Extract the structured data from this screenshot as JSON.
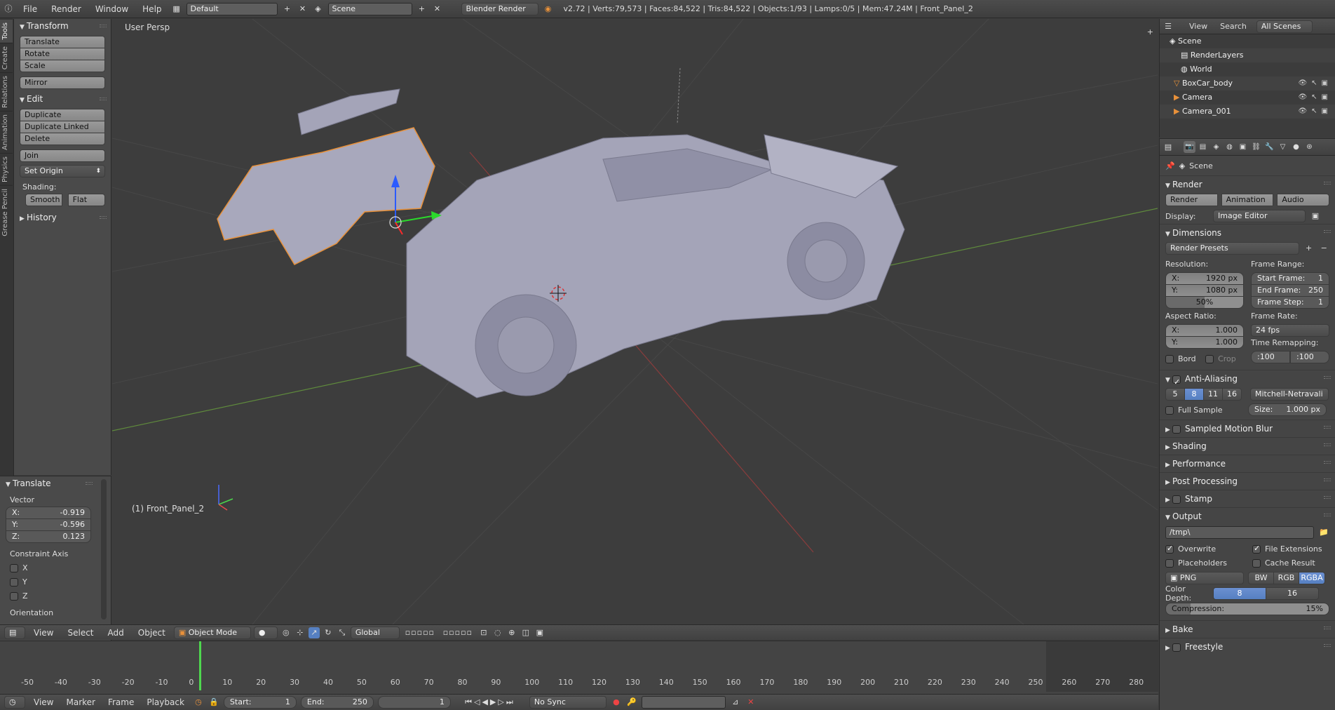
{
  "topbar": {
    "menus": [
      "File",
      "Render",
      "Window",
      "Help"
    ],
    "layout": "Default",
    "scene": "Scene",
    "engine": "Blender Render",
    "stats": "v2.72 | Verts:79,573 | Faces:84,522 | Tris:84,522 | Objects:1/93 | Lamps:0/5 | Mem:47.24M | Front_Panel_2"
  },
  "tabs": [
    "Tools",
    "Create",
    "Relations",
    "Animation",
    "Physics",
    "Grease Pencil"
  ],
  "shelf": {
    "transform_title": "Transform",
    "translate": "Translate",
    "rotate": "Rotate",
    "scale": "Scale",
    "mirror": "Mirror",
    "edit_title": "Edit",
    "duplicate": "Duplicate",
    "duplicate_linked": "Duplicate Linked",
    "delete": "Delete",
    "join": "Join",
    "set_origin": "Set Origin",
    "shading_label": "Shading:",
    "smooth": "Smooth",
    "flat": "Flat",
    "history_title": "History"
  },
  "operator": {
    "title": "Translate",
    "vector_label": "Vector",
    "x_label": "X:",
    "x_value": "-0.919",
    "y_label": "Y:",
    "y_value": "-0.596",
    "z_label": "Z:",
    "z_value": "0.123",
    "constraint_label": "Constraint Axis",
    "cx": "X",
    "cy": "Y",
    "cz": "Z",
    "orientation_label": "Orientation"
  },
  "viewport": {
    "view_name": "User Persp",
    "object_label": "(1) Front_Panel_2"
  },
  "vpheader": {
    "menus": [
      "View",
      "Select",
      "Add",
      "Object"
    ],
    "mode": "Object Mode",
    "orientation": "Global"
  },
  "timeline": {
    "ticks": [
      "-50",
      "-40",
      "-30",
      "-20",
      "-10",
      "0",
      "10",
      "20",
      "30",
      "40",
      "50",
      "60",
      "70",
      "80",
      "90",
      "100",
      "110",
      "120",
      "130",
      "140",
      "150",
      "160",
      "170",
      "180",
      "190",
      "200",
      "210",
      "220",
      "230",
      "240",
      "250",
      "260",
      "270",
      "280"
    ],
    "current_frame": "0"
  },
  "tlheader": {
    "menus": [
      "View",
      "Marker",
      "Frame",
      "Playback"
    ],
    "start_label": "Start:",
    "start_value": "1",
    "end_label": "End:",
    "end_value": "250",
    "current": "1",
    "sync": "No Sync"
  },
  "outliner": {
    "view": "View",
    "search": "Search",
    "filter": "All Scenes",
    "items": [
      "Scene",
      "RenderLayers",
      "World",
      "BoxCar_body",
      "Camera",
      "Camera_001"
    ]
  },
  "props": {
    "breadcrumb": "Scene",
    "render_title": "Render",
    "render_btn": "Render",
    "animation_btn": "Animation",
    "audio_btn": "Audio",
    "display_label": "Display:",
    "display_value": "Image Editor",
    "dimensions_title": "Dimensions",
    "render_presets": "Render Presets",
    "resolution_label": "Resolution:",
    "res_x_label": "X:",
    "res_x": "1920 px",
    "res_y_label": "Y:",
    "res_y": "1080 px",
    "res_pct": "50%",
    "frame_range_label": "Frame Range:",
    "start_frame_label": "Start Frame:",
    "start_frame": "1",
    "end_frame_label": "End Frame:",
    "end_frame": "250",
    "frame_step_label": "Frame Step:",
    "frame_step": "1",
    "aspect_label": "Aspect Ratio:",
    "asp_x_label": "X:",
    "asp_x": "1.000",
    "asp_y_label": "Y:",
    "asp_y": "1.000",
    "frame_rate_label": "Frame Rate:",
    "frame_rate": "24 fps",
    "time_remap_label": "Time Remapping:",
    "remap_old": ":100",
    "remap_new": ":100",
    "bord": "Bord",
    "crop": "Crop",
    "aa_title": "Anti-Aliasing",
    "aa_samples": [
      "5",
      "8",
      "11",
      "16"
    ],
    "aa_filter": "Mitchell-Netravali",
    "full_sample": "Full Sample",
    "size_label": "Size:",
    "size_value": "1.000 px",
    "motion_blur_title": "Sampled Motion Blur",
    "shading_title": "Shading",
    "performance_title": "Performance",
    "post_title": "Post Processing",
    "stamp_title": "Stamp",
    "output_title": "Output",
    "output_path": "/tmp\\",
    "overwrite": "Overwrite",
    "file_ext": "File Extensions",
    "placeholders": "Placeholders",
    "cache_result": "Cache Result",
    "format": "PNG",
    "bw": "BW",
    "rgb": "RGB",
    "rgba": "RGBA",
    "color_depth_label": "Color Depth:",
    "depth_8": "8",
    "depth_16": "16",
    "compression_label": "Compression:",
    "compression_value": "15%",
    "bake_title": "Bake",
    "freestyle_title": "Freestyle"
  }
}
